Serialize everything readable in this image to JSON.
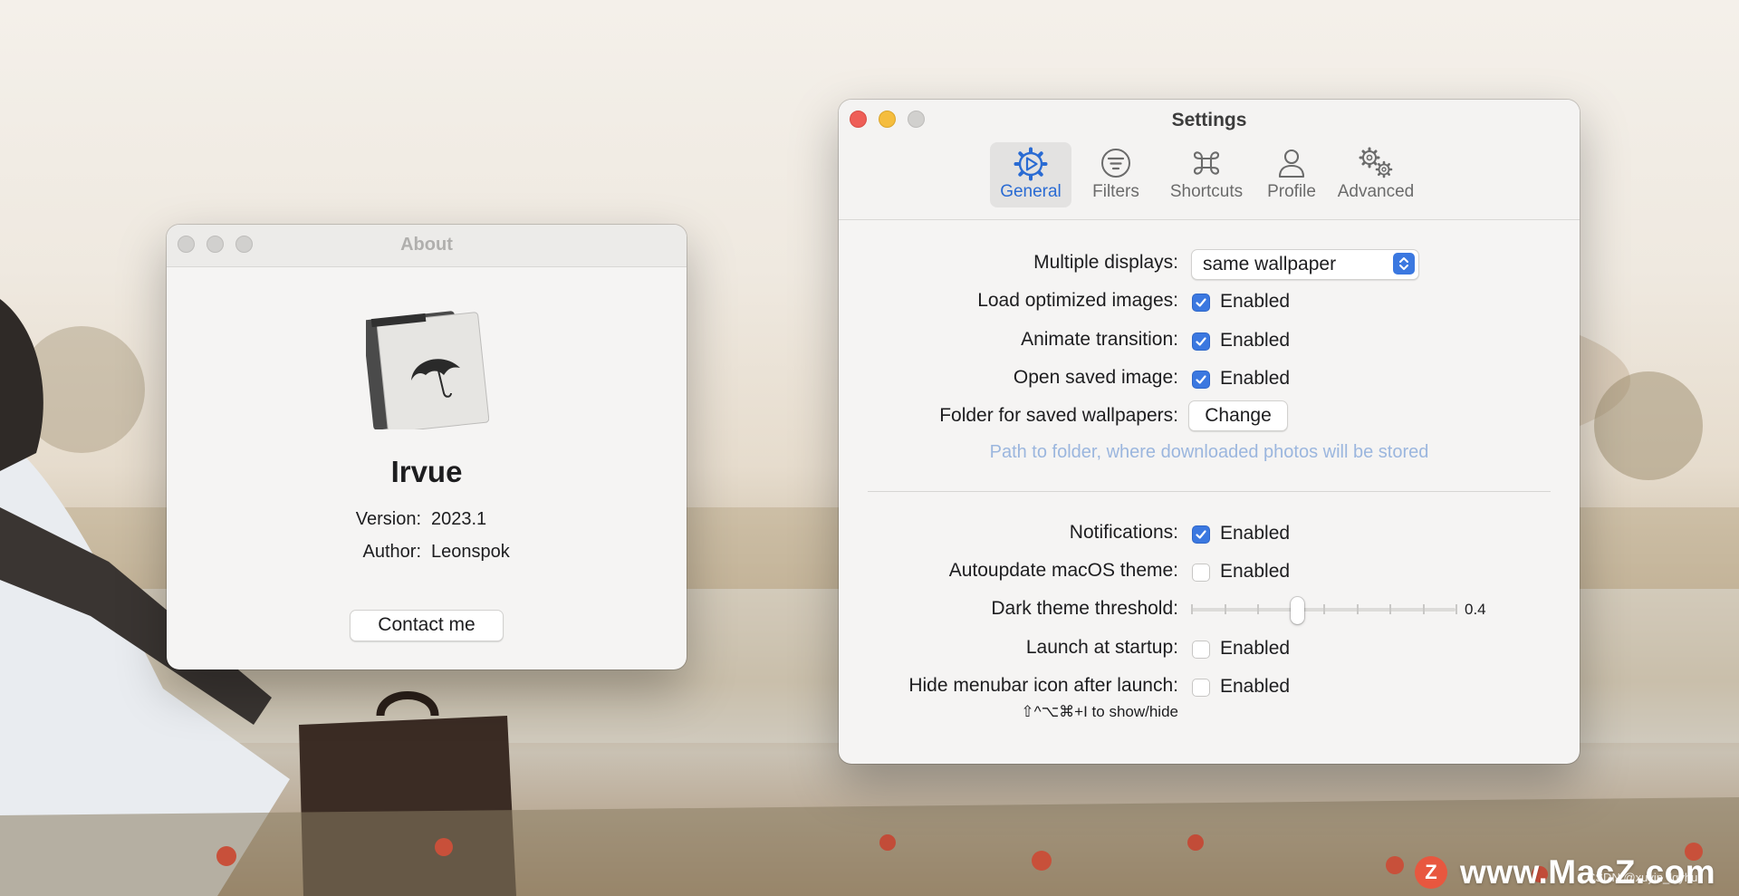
{
  "about": {
    "title": "About",
    "app_name": "Irvue",
    "version_label": "Version:",
    "version": "2023.1",
    "author_label": "Author:",
    "author": "Leonspok",
    "contact_label": "Contact me"
  },
  "settings": {
    "title": "Settings",
    "tabs": [
      {
        "label": "General",
        "icon": "gear-play-icon",
        "active": true
      },
      {
        "label": "Filters",
        "icon": "filter-icon",
        "active": false
      },
      {
        "label": "Shortcuts",
        "icon": "command-icon",
        "active": false
      },
      {
        "label": "Profile",
        "icon": "person-icon",
        "active": false
      },
      {
        "label": "Advanced",
        "icon": "gears-icon",
        "active": false
      }
    ],
    "multiple_displays": {
      "label": "Multiple displays:",
      "value": "same wallpaper"
    },
    "load_optimized": {
      "label": "Load optimized images:",
      "checkbox": "Enabled",
      "checked": true
    },
    "animate_transition": {
      "label": "Animate transition:",
      "checkbox": "Enabled",
      "checked": true
    },
    "open_saved": {
      "label": "Open saved image:",
      "checkbox": "Enabled",
      "checked": true
    },
    "folder": {
      "label": "Folder for saved wallpapers:",
      "button": "Change",
      "hint": "Path to folder, where downloaded photos will be stored"
    },
    "notifications": {
      "label": "Notifications:",
      "checkbox": "Enabled",
      "checked": true
    },
    "autoupdate_theme": {
      "label": "Autoupdate macOS theme:",
      "checkbox": "Enabled",
      "checked": false
    },
    "dark_threshold": {
      "label": "Dark theme threshold:",
      "value": "0.4",
      "level": 0.4
    },
    "launch_startup": {
      "label": "Launch at startup:",
      "checkbox": "Enabled",
      "checked": false
    },
    "hide_menubar": {
      "label": "Hide menubar icon after launch:",
      "checkbox": "Enabled",
      "checked": false,
      "shortcut": "⇧^⌥⌘+I to show/hide"
    }
  },
  "watermark": {
    "logo": "Z",
    "text": "www.MacZ.com",
    "credit": "CSDN @xuyin_lgyhu"
  },
  "colors": {
    "accent": "#3b78e0",
    "close": "#ee5e57",
    "minimize": "#f5bd3e",
    "hint": "#9bb6de"
  }
}
